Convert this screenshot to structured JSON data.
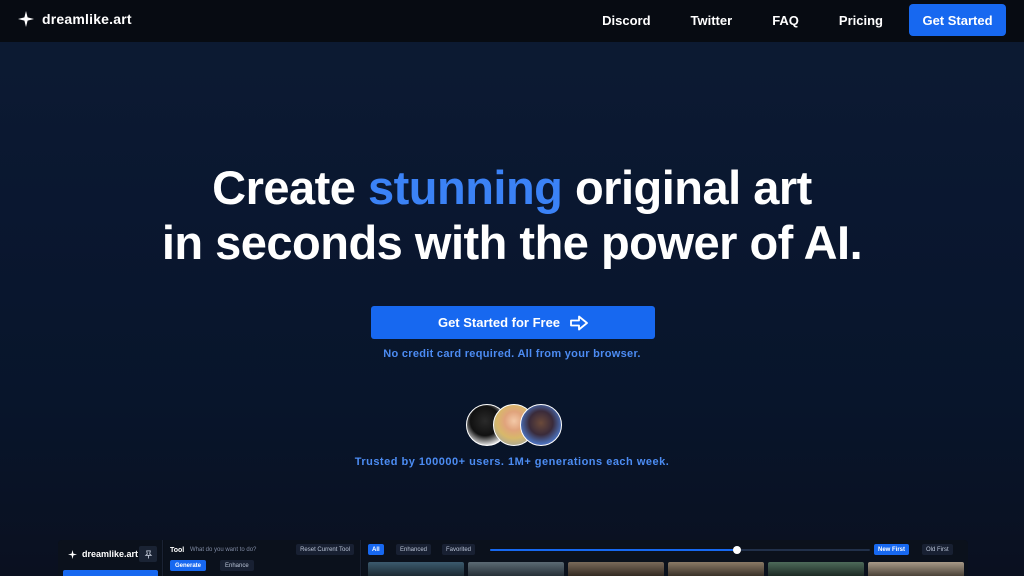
{
  "nav": {
    "brand": "dreamlike.art",
    "links": [
      "Discord",
      "Twitter",
      "FAQ",
      "Pricing"
    ],
    "cta": "Get Started"
  },
  "hero": {
    "line1_pre": "Create ",
    "line1_accent": "stunning",
    "line1_post": " original art",
    "line2": "in seconds with the power of AI.",
    "cta": "Get Started for Free",
    "note": "No credit card required. All from your browser.",
    "trusted": "Trusted by 100000+ users. 1M+ generations each week."
  },
  "app_preview": {
    "brand": "dreamlike.art",
    "tool_label": "Tool",
    "prompt_placeholder": "What do you want to do?",
    "reset_label": "Reset Current Tool",
    "generate_label": "Generate",
    "enhance_label": "Enhance",
    "filter_all": "All",
    "filter_enhanced": "Enhanced",
    "filter_favorited": "Favorited",
    "slider_value": 0.65,
    "sort_new": "New First",
    "sort_old": "Old First"
  },
  "colors": {
    "accent": "#3b82f6",
    "button": "#1768f0",
    "note_text": "#4c8cf3"
  }
}
